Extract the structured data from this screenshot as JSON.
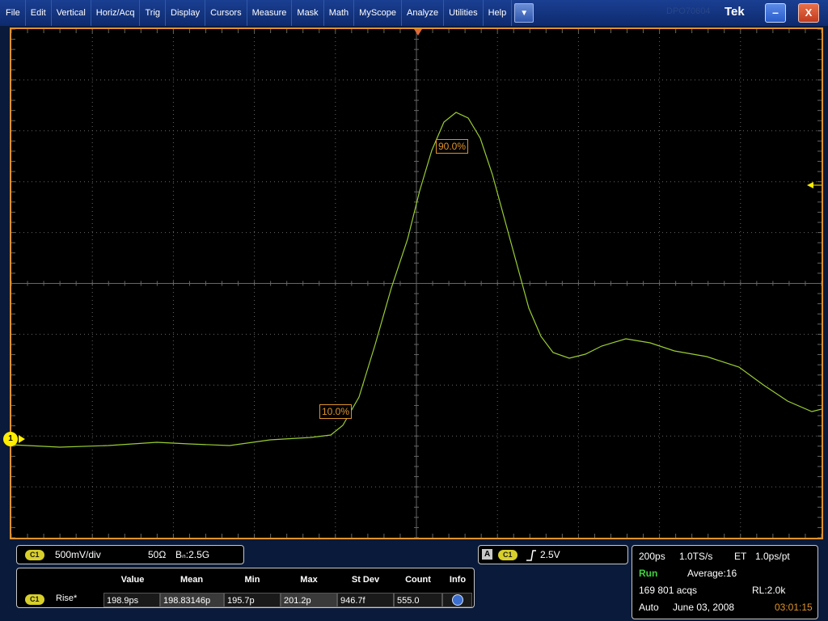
{
  "menu": {
    "items": [
      "File",
      "Edit",
      "Vertical",
      "Horiz/Acq",
      "Trig",
      "Display",
      "Cursors",
      "Measure",
      "Mask",
      "Math",
      "MyScope",
      "Analyze",
      "Utilities",
      "Help"
    ],
    "dropdown_icon": "chevron-down-icon"
  },
  "window": {
    "brand": "Tek",
    "brand_ghost": "DPO70604",
    "minimize_glyph": "–",
    "close_glyph": "X"
  },
  "display": {
    "channel_marker": "1",
    "ref_10": "10.0%",
    "ref_90": "90.0%",
    "colors": {
      "trace": "#9acd32",
      "border": "#e0922a",
      "grid": "#666666",
      "marker": "#ffee00"
    }
  },
  "channel_panel": {
    "badge": "C1",
    "vdiv": "500mV/div",
    "impedance": "50Ω",
    "bandwidth": "Bₙ:2.5G"
  },
  "measurement": {
    "headers": [
      "Value",
      "Mean",
      "Min",
      "Max",
      "St Dev",
      "Count",
      "Info"
    ],
    "badge": "C1",
    "label": "Rise*",
    "value": "198.9ps",
    "mean": "198.83146p",
    "min": "195.7p",
    "max": "201.2p",
    "stdev": "946.7f",
    "count": "555.0",
    "info_icon": "info-icon"
  },
  "trigger_panel": {
    "source": "A",
    "badge": "C1",
    "slope_icon": "rising-edge-icon",
    "level": "2.5V"
  },
  "acq_panel": {
    "timebase": "200ps",
    "sample_rate": "1.0TS/s",
    "mode": "ET",
    "resolution": "1.0ps/pt",
    "state": "Run",
    "average": "Average:16",
    "acqs": "169 801 acqs",
    "record_length": "RL:2.0k",
    "trigger_mode": "Auto",
    "date": "June 03, 2008",
    "time": "03:01:15"
  }
}
